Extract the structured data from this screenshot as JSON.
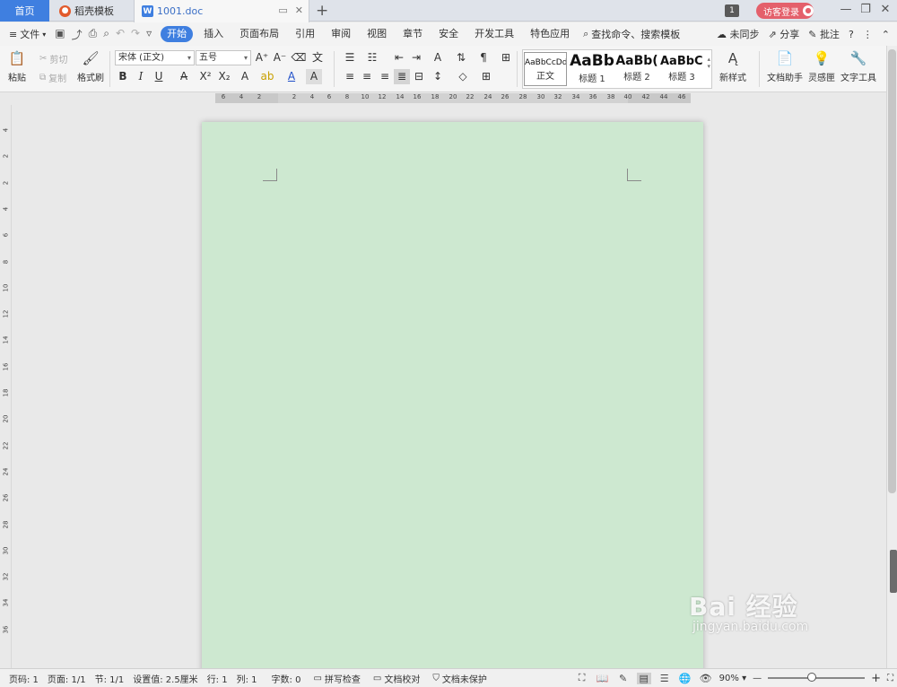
{
  "tabs": {
    "home": "首页",
    "templates": "稻壳模板",
    "doc": "1001.doc",
    "add": "+"
  },
  "topbar": {
    "badge": "1",
    "login": "访客登录"
  },
  "menu": {
    "file": "文件",
    "tabs": [
      "开始",
      "插入",
      "页面布局",
      "引用",
      "审阅",
      "视图",
      "章节",
      "安全",
      "开发工具",
      "特色应用"
    ],
    "search": "查找命令、搜索模板",
    "sync": "未同步",
    "share": "分享",
    "comment": "批注",
    "help": "?"
  },
  "ribbon": {
    "paste": "粘贴",
    "cut": "剪切",
    "copy": "复制",
    "format_painter": "格式刷",
    "font_name": "宋体 (正文)",
    "font_size": "五号",
    "bold": "B",
    "italic": "I",
    "underline": "U",
    "styles": [
      {
        "sample": "AaBbCcDd",
        "label": "正文"
      },
      {
        "sample": "AaBb",
        "label": "标题 1"
      },
      {
        "sample": "AaBb(",
        "label": "标题 2"
      },
      {
        "sample": "AaBbC(",
        "label": "标题 3"
      }
    ],
    "new_style": "新样式",
    "doc_assistant": "文档助手",
    "inspiration": "灵感匣",
    "text_tools": "文字工具"
  },
  "ruler": {
    "h_ticks": [
      "6",
      "4",
      "2",
      "2",
      "4",
      "6",
      "8",
      "10",
      "12",
      "14",
      "16",
      "18",
      "20",
      "22",
      "24",
      "26",
      "28",
      "30",
      "32",
      "34",
      "36",
      "38",
      "40",
      "42",
      "44",
      "46"
    ],
    "v_ticks": [
      "4",
      "2",
      "2",
      "4",
      "6",
      "8",
      "10",
      "12",
      "14",
      "16",
      "18",
      "20",
      "22",
      "24",
      "26",
      "28",
      "30",
      "32",
      "34",
      "36"
    ]
  },
  "status": {
    "page_num": "页码: 1",
    "pages": "页面: 1/1",
    "section": "节: 1/1",
    "setting": "设置值: 2.5厘米",
    "row": "行: 1",
    "col": "列: 1",
    "word_count": "字数: 0",
    "spell_check": "拼写检查",
    "doc_proof": "文档校对",
    "doc_protect": "文档未保护",
    "zoom": "90%"
  },
  "watermark": {
    "main": "Bai 经验",
    "sub": "jingyan.baidu.com"
  },
  "colors": {
    "accent": "#3f7fe0",
    "page_bg": "#cde8d0",
    "login_bg": "#e4606b"
  }
}
